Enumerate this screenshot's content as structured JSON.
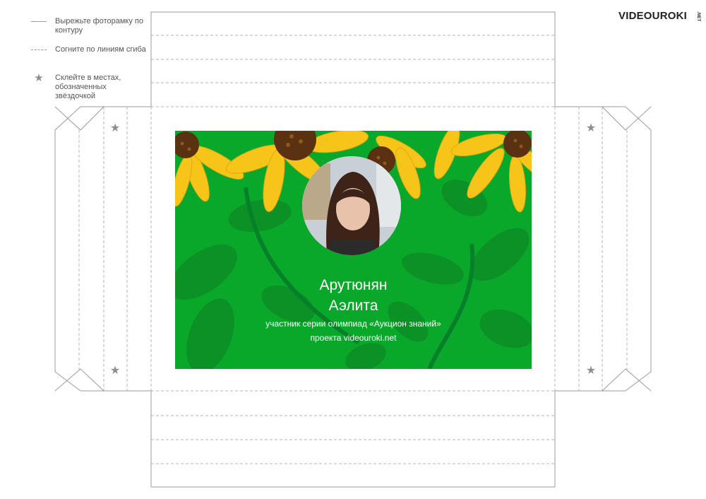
{
  "legend": {
    "cut": "Вырежьте фоторамку по контуру",
    "fold": "Согните по линиям сгиба",
    "glue": "Склейте в местах, обозначенных звёздочкой"
  },
  "logo": {
    "brand": "VIDEOUROKI",
    "tld": ".NET"
  },
  "card": {
    "name_first": "Арутюнян",
    "name_last": "Аэлита",
    "subtitle": "участник серии олимпиад «Аукцион знаний»",
    "project": "проекта videouroki.net"
  },
  "colors": {
    "card_green": "#0aa82a",
    "leaf_green": "#0c8f25",
    "petal_yellow": "#f7c51a",
    "seed_brown": "#5a3212",
    "cut_line": "#9b9b9b"
  },
  "icons": [
    "star-icon"
  ]
}
